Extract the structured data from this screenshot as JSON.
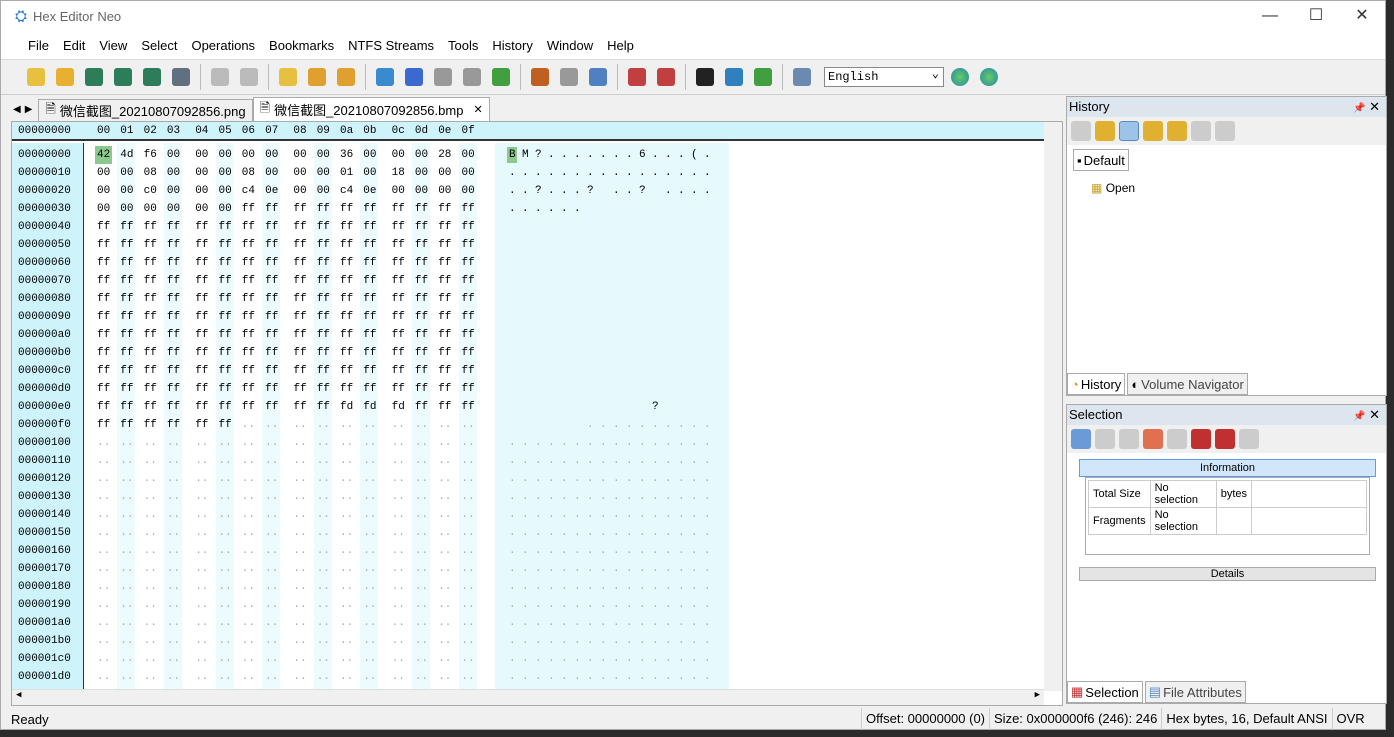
{
  "window": {
    "title": "Hex Editor Neo",
    "minimize": "—",
    "maximize": "☐",
    "close": "✕"
  },
  "menu": [
    "File",
    "Edit",
    "View",
    "Select",
    "Operations",
    "Bookmarks",
    "NTFS Streams",
    "Tools",
    "History",
    "Window",
    "Help"
  ],
  "toolbar": {
    "language": "English",
    "icons": [
      "new-file",
      "open-file",
      "save",
      "save-all",
      "save-as",
      "print",
      "undo",
      "redo",
      "edit",
      "copy",
      "paste",
      "export",
      "find",
      "find-next",
      "find-prev",
      "goto",
      "bit-view",
      "encoding",
      "pattern",
      "compare",
      "checksum",
      "binary",
      "fullscreen",
      "highlighter",
      "help-f1"
    ]
  },
  "tabs": [
    {
      "label": "微信截图_20210807092856.png"
    },
    {
      "label": "微信截图_20210807092856.bmp",
      "close": "✕"
    }
  ],
  "tab_nav": {
    "left": "◀",
    "right": "▶"
  },
  "editor": {
    "header_offset": "00000000",
    "columns": [
      "00",
      "01",
      "02",
      "03",
      "04",
      "05",
      "06",
      "07",
      "08",
      "09",
      "0a",
      "0b",
      "0c",
      "0d",
      "0e",
      "0f"
    ],
    "rows": [
      {
        "o": "00000000",
        "h": [
          "42",
          "4d",
          "f6",
          "00",
          "00",
          "00",
          "00",
          "00",
          "00",
          "00",
          "36",
          "00",
          "00",
          "00",
          "28",
          "00"
        ],
        "a": "BM?.......6...(."
      },
      {
        "o": "00000010",
        "h": [
          "00",
          "00",
          "08",
          "00",
          "00",
          "00",
          "08",
          "00",
          "00",
          "00",
          "01",
          "00",
          "18",
          "00",
          "00",
          "00"
        ],
        "a": "................"
      },
      {
        "o": "00000020",
        "h": [
          "00",
          "00",
          "c0",
          "00",
          "00",
          "00",
          "c4",
          "0e",
          "00",
          "00",
          "c4",
          "0e",
          "00",
          "00",
          "00",
          "00"
        ],
        "a": "..?...? ..? ...."
      },
      {
        "o": "00000030",
        "h": [
          "00",
          "00",
          "00",
          "00",
          "00",
          "00",
          "ff",
          "ff",
          "ff",
          "ff",
          "ff",
          "ff",
          "ff",
          "ff",
          "ff",
          "ff"
        ],
        "a": "......"
      },
      {
        "o": "00000040",
        "h": [
          "ff",
          "ff",
          "ff",
          "ff",
          "ff",
          "ff",
          "ff",
          "ff",
          "ff",
          "ff",
          "ff",
          "ff",
          "ff",
          "ff",
          "ff",
          "ff"
        ],
        "a": ""
      },
      {
        "o": "00000050",
        "h": [
          "ff",
          "ff",
          "ff",
          "ff",
          "ff",
          "ff",
          "ff",
          "ff",
          "ff",
          "ff",
          "ff",
          "ff",
          "ff",
          "ff",
          "ff",
          "ff"
        ],
        "a": ""
      },
      {
        "o": "00000060",
        "h": [
          "ff",
          "ff",
          "ff",
          "ff",
          "ff",
          "ff",
          "ff",
          "ff",
          "ff",
          "ff",
          "ff",
          "ff",
          "ff",
          "ff",
          "ff",
          "ff"
        ],
        "a": ""
      },
      {
        "o": "00000070",
        "h": [
          "ff",
          "ff",
          "ff",
          "ff",
          "ff",
          "ff",
          "ff",
          "ff",
          "ff",
          "ff",
          "ff",
          "ff",
          "ff",
          "ff",
          "ff",
          "ff"
        ],
        "a": ""
      },
      {
        "o": "00000080",
        "h": [
          "ff",
          "ff",
          "ff",
          "ff",
          "ff",
          "ff",
          "ff",
          "ff",
          "ff",
          "ff",
          "ff",
          "ff",
          "ff",
          "ff",
          "ff",
          "ff"
        ],
        "a": ""
      },
      {
        "o": "00000090",
        "h": [
          "ff",
          "ff",
          "ff",
          "ff",
          "ff",
          "ff",
          "ff",
          "ff",
          "ff",
          "ff",
          "ff",
          "ff",
          "ff",
          "ff",
          "ff",
          "ff"
        ],
        "a": ""
      },
      {
        "o": "000000a0",
        "h": [
          "ff",
          "ff",
          "ff",
          "ff",
          "ff",
          "ff",
          "ff",
          "ff",
          "ff",
          "ff",
          "ff",
          "ff",
          "ff",
          "ff",
          "ff",
          "ff"
        ],
        "a": ""
      },
      {
        "o": "000000b0",
        "h": [
          "ff",
          "ff",
          "ff",
          "ff",
          "ff",
          "ff",
          "ff",
          "ff",
          "ff",
          "ff",
          "ff",
          "ff",
          "ff",
          "ff",
          "ff",
          "ff"
        ],
        "a": ""
      },
      {
        "o": "000000c0",
        "h": [
          "ff",
          "ff",
          "ff",
          "ff",
          "ff",
          "ff",
          "ff",
          "ff",
          "ff",
          "ff",
          "ff",
          "ff",
          "ff",
          "ff",
          "ff",
          "ff"
        ],
        "a": ""
      },
      {
        "o": "000000d0",
        "h": [
          "ff",
          "ff",
          "ff",
          "ff",
          "ff",
          "ff",
          "ff",
          "ff",
          "ff",
          "ff",
          "ff",
          "ff",
          "ff",
          "ff",
          "ff",
          "ff"
        ],
        "a": ""
      },
      {
        "o": "000000e0",
        "h": [
          "ff",
          "ff",
          "ff",
          "ff",
          "ff",
          "ff",
          "ff",
          "ff",
          "ff",
          "ff",
          "fd",
          "fd",
          "fd",
          "ff",
          "ff",
          "ff"
        ],
        "a": "           ?    "
      },
      {
        "o": "000000f0",
        "h": [
          "ff",
          "ff",
          "ff",
          "ff",
          "ff",
          "ff"
        ],
        "a": "      .........."
      },
      {
        "o": "00000100",
        "h": [],
        "a": "................"
      },
      {
        "o": "00000110",
        "h": [],
        "a": "................"
      },
      {
        "o": "00000120",
        "h": [],
        "a": "................"
      },
      {
        "o": "00000130",
        "h": [],
        "a": "................"
      },
      {
        "o": "00000140",
        "h": [],
        "a": "................"
      },
      {
        "o": "00000150",
        "h": [],
        "a": "................"
      },
      {
        "o": "00000160",
        "h": [],
        "a": "................"
      },
      {
        "o": "00000170",
        "h": [],
        "a": "................"
      },
      {
        "o": "00000180",
        "h": [],
        "a": "................"
      },
      {
        "o": "00000190",
        "h": [],
        "a": "................"
      },
      {
        "o": "000001a0",
        "h": [],
        "a": "................"
      },
      {
        "o": "000001b0",
        "h": [],
        "a": "................"
      },
      {
        "o": "000001c0",
        "h": [],
        "a": "................"
      },
      {
        "o": "000001d0",
        "h": [],
        "a": "................"
      }
    ],
    "empty_cell": "..",
    "highlight_color": "#8cc98e"
  },
  "history": {
    "title": "History",
    "pin": "📌",
    "close": "✕",
    "tab": "Default",
    "item": "Open",
    "bottom_tabs": [
      "History",
      "Volume Navigator"
    ]
  },
  "selection": {
    "title": "Selection",
    "pin": "📌",
    "close": "✕",
    "info_header": "Information",
    "rows": [
      [
        "Total Size",
        "No selection",
        "bytes"
      ],
      [
        "Fragments",
        "No selection",
        ""
      ]
    ],
    "details": "Details",
    "bottom_tabs": [
      "Selection",
      "File Attributes"
    ]
  },
  "status": {
    "ready": "Ready",
    "offset": "Offset: 00000000 (0)",
    "size": "Size: 0x000000f6 (246): 246",
    "mode": "Hex bytes, 16, Default ANSI",
    "ovr": "OVR"
  }
}
